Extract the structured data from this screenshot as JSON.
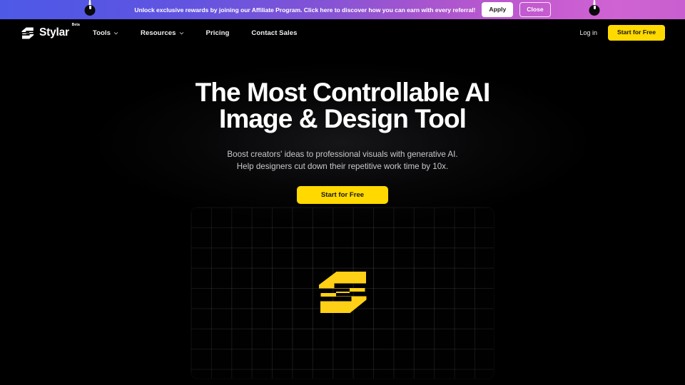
{
  "promo_banner": {
    "message": "Unlock exclusive rewards by joining our Affiliate Program. Click here to discover how you can earn with every referral!",
    "apply_label": "Apply",
    "close_label": "Close",
    "gradient_start": "#4e5ae6",
    "gradient_end": "#c85ecf"
  },
  "navbar": {
    "brand_name": "Stylar",
    "brand_badge": "Beta",
    "links": [
      {
        "label": "Tools",
        "has_dropdown": true
      },
      {
        "label": "Resources",
        "has_dropdown": true
      },
      {
        "label": "Pricing",
        "has_dropdown": false
      },
      {
        "label": "Contact Sales",
        "has_dropdown": false
      }
    ],
    "login_label": "Log in",
    "cta_label": "Start for Free",
    "cta_color": "#ffd900"
  },
  "hero": {
    "title_line1": "The Most Controllable AI",
    "title_line2": "Image & Design Tool",
    "subtitle_line1": "Boost creators' ideas to professional visuals with generative AI.",
    "subtitle_line2": "Help designers cut down their repetitive work time by 10x.",
    "cta_label": "Start for Free",
    "cta_color": "#ffd900"
  },
  "canvas_preview": {
    "background_color": "#010101",
    "grid_color": "rgba(255,255,255,0.115)",
    "logo_color": "#ffd016"
  }
}
